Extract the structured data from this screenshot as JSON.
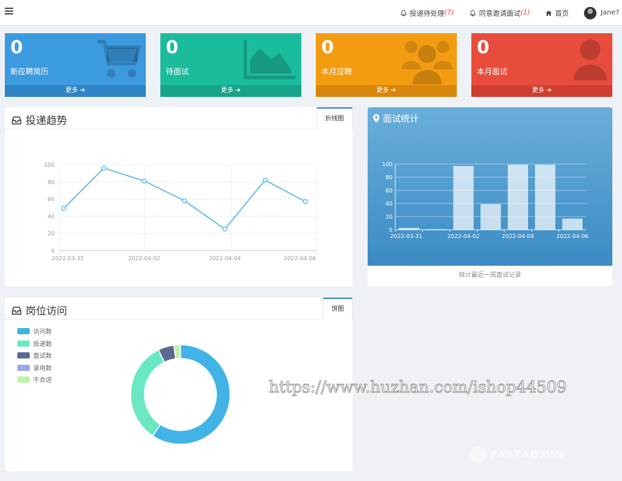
{
  "topbar": {
    "nav": [
      {
        "label": "投递待处理",
        "count": "(7)"
      },
      {
        "label": "同意邀请面试",
        "count": "(1)"
      },
      {
        "label": "首页"
      },
      {
        "label": "Jane?"
      }
    ]
  },
  "cards": [
    {
      "value": "0",
      "label": "新应聘简历",
      "more": "更多",
      "icon": "cart-icon"
    },
    {
      "value": "0",
      "label": "待面试",
      "more": "更多",
      "icon": "area-chart-icon"
    },
    {
      "value": "0",
      "label": "本月应聘",
      "more": "更多",
      "icon": "users-icon"
    },
    {
      "value": "0",
      "label": "本月面试",
      "more": "更多",
      "icon": "user-icon"
    }
  ],
  "trend_panel": {
    "title": "投递趋势",
    "tab": "折线图"
  },
  "interview_panel": {
    "title": "面试统计",
    "footer": "统计最近一周面试记录"
  },
  "position_panel": {
    "title": "岗位访问",
    "tab": "饼图"
  },
  "watermark": "https://www.huzhan.com/ishop44509",
  "brand_watermark": "FASTADMIN",
  "colors": {
    "blue": "#3c9adf",
    "green": "#1abc9c",
    "orange": "#f39c12",
    "red": "#e74c3c",
    "line": "#4db3e6"
  },
  "chart_data": [
    {
      "type": "line",
      "x": [
        "2022-03-31",
        "2022-04-01",
        "2022-04-02",
        "2022-04-03",
        "2022-04-04",
        "2022-04-05",
        "2022-04-06"
      ],
      "x_tick_labels": [
        "2022-03-31",
        "2022-04-02",
        "2022-04-04",
        "2022-04-06"
      ],
      "values": [
        49,
        96,
        81,
        58,
        25,
        82,
        57
      ],
      "ylim": [
        0,
        100
      ],
      "yticks": [
        0,
        20,
        40,
        60,
        80,
        100
      ],
      "grid": true
    },
    {
      "type": "bar",
      "categories": [
        "2022-03-31",
        "2022-04-01",
        "2022-04-02",
        "2022-04-03",
        "2022-04-04",
        "2022-04-05",
        "2022-04-06"
      ],
      "x_tick_labels": [
        "2022-03-31",
        "2022-04-02",
        "2022-04-04",
        "2022-04-06"
      ],
      "values": [
        3,
        1,
        97,
        39,
        99,
        99,
        17
      ],
      "ylim": [
        0,
        100
      ],
      "yticks": [
        0,
        20,
        40,
        60,
        80,
        100
      ],
      "grid": true
    },
    {
      "type": "pie",
      "donut": true,
      "legend_position": "top-left",
      "labels": [
        "访问数",
        "投递数",
        "面试数",
        "录用数",
        "不合适"
      ],
      "values": [
        57,
        32,
        5,
        0,
        2
      ],
      "colors": [
        "#41b3e6",
        "#6ae8c3",
        "#5b6a90",
        "#99a9e8",
        "#bdf2a8"
      ]
    }
  ]
}
